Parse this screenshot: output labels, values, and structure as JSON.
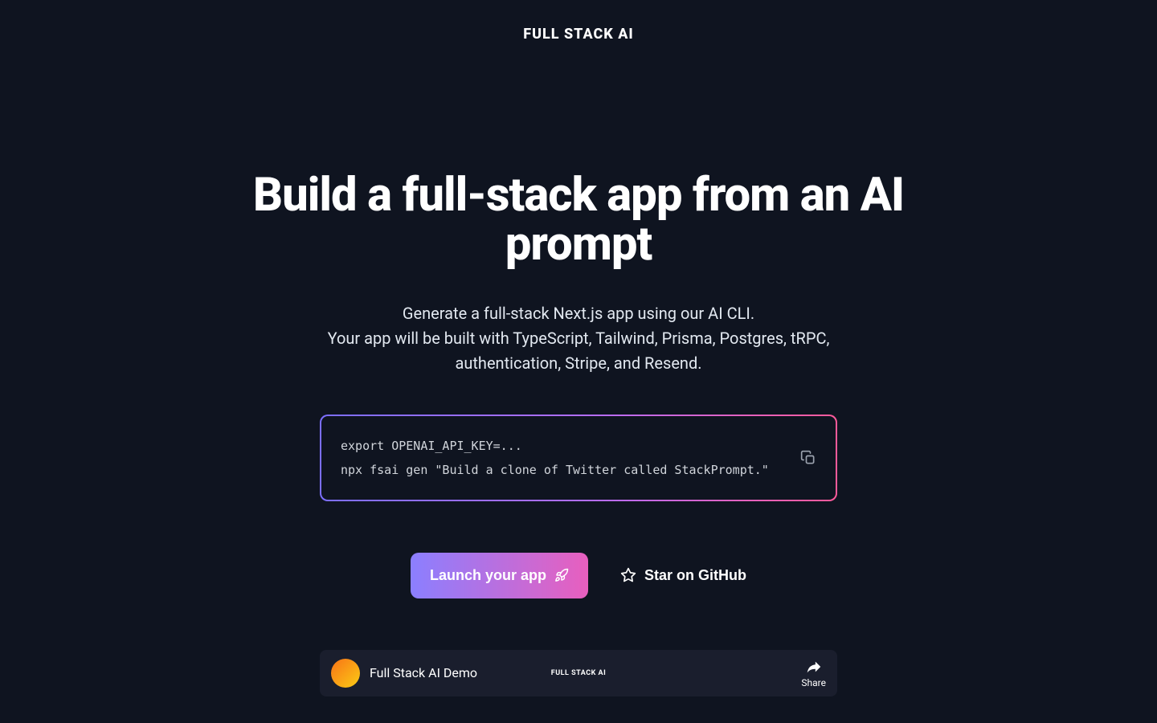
{
  "header": {
    "logo": "FULL STACK AI"
  },
  "hero": {
    "title": "Build a full-stack app from an AI prompt",
    "description": "Generate a full-stack Next.js app using our AI CLI.\nYour app will be built with TypeScript, Tailwind, Prisma, Postgres, tRPC, authentication, Stripe, and Resend."
  },
  "code": {
    "content": "export OPENAI_API_KEY=...\nnpx fsai gen \"Build a clone of Twitter called StackPrompt.\""
  },
  "buttons": {
    "launch": "Launch your app",
    "github": "Star on GitHub"
  },
  "video": {
    "title": "Full Stack AI Demo",
    "center_logo": "FULL STACK AI",
    "share": "Share"
  }
}
